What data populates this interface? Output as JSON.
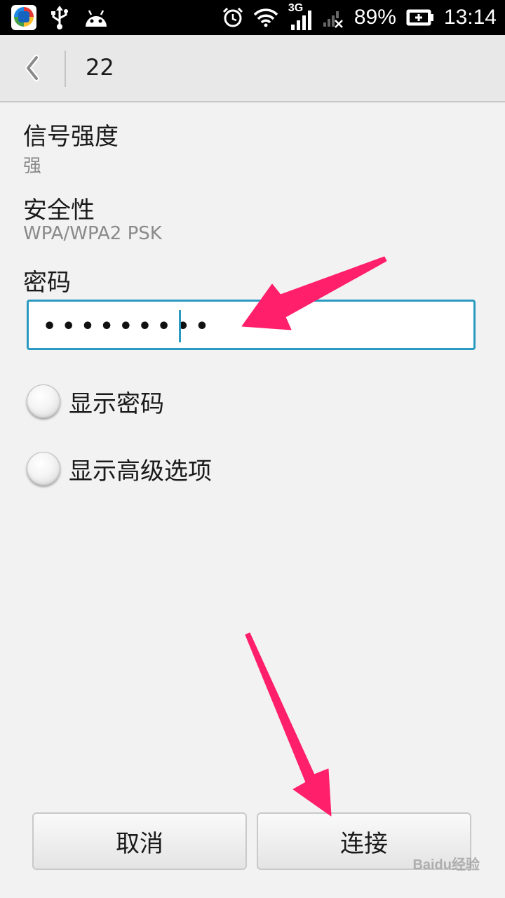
{
  "status_bar": {
    "network_type": "3G",
    "battery_percent": "89%",
    "time": "13:14",
    "icons": [
      "app-store-icon",
      "usb-icon",
      "android-icon",
      "alarm-icon",
      "wifi-icon",
      "cell-signal-icon",
      "cell-signal-no-data-icon",
      "battery-icon"
    ]
  },
  "header": {
    "back_icon": "chevron-left-icon",
    "title": "22"
  },
  "fields": {
    "signal_label": "信号强度",
    "signal_value": "强",
    "security_label": "安全性",
    "security_value": "WPA/WPA2 PSK",
    "password_label": "密码",
    "password_masked": "•••••••••"
  },
  "options": {
    "show_password": "显示密码",
    "show_advanced": "显示高级选项"
  },
  "buttons": {
    "cancel": "取消",
    "connect": "连接"
  },
  "annotations": {
    "arrow_color": "#ff1f6a"
  },
  "watermark": "Baidu经验"
}
